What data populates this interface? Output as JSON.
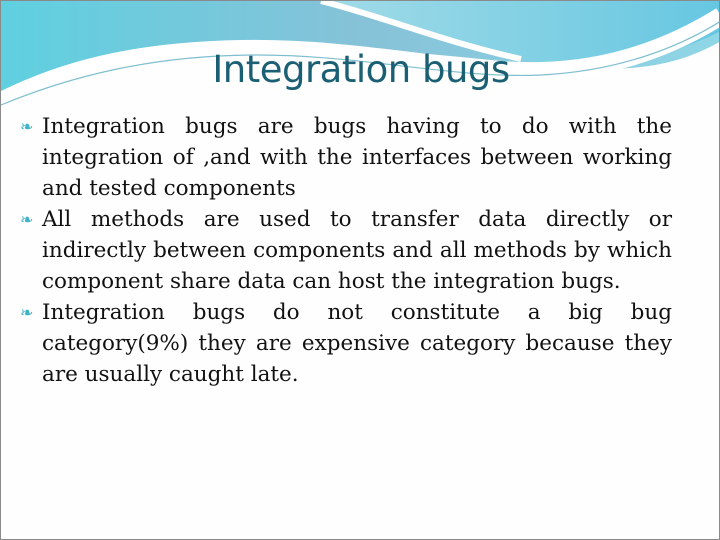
{
  "slide": {
    "title": "Integration bugs",
    "bullet_icon": "swirl-bullet-icon",
    "accent_color": "#3fb4c6",
    "title_color": "#1b5f74",
    "bullets": [
      "Integration bugs are bugs having to do with the integration of ,and with the interfaces between working and tested components",
      "All methods are used to transfer data directly or indirectly between components and all methods by which component share data can host the integration bugs.",
      "Integration bugs do not constitute a big bug category(9%) they are expensive category because they are usually caught late."
    ]
  }
}
